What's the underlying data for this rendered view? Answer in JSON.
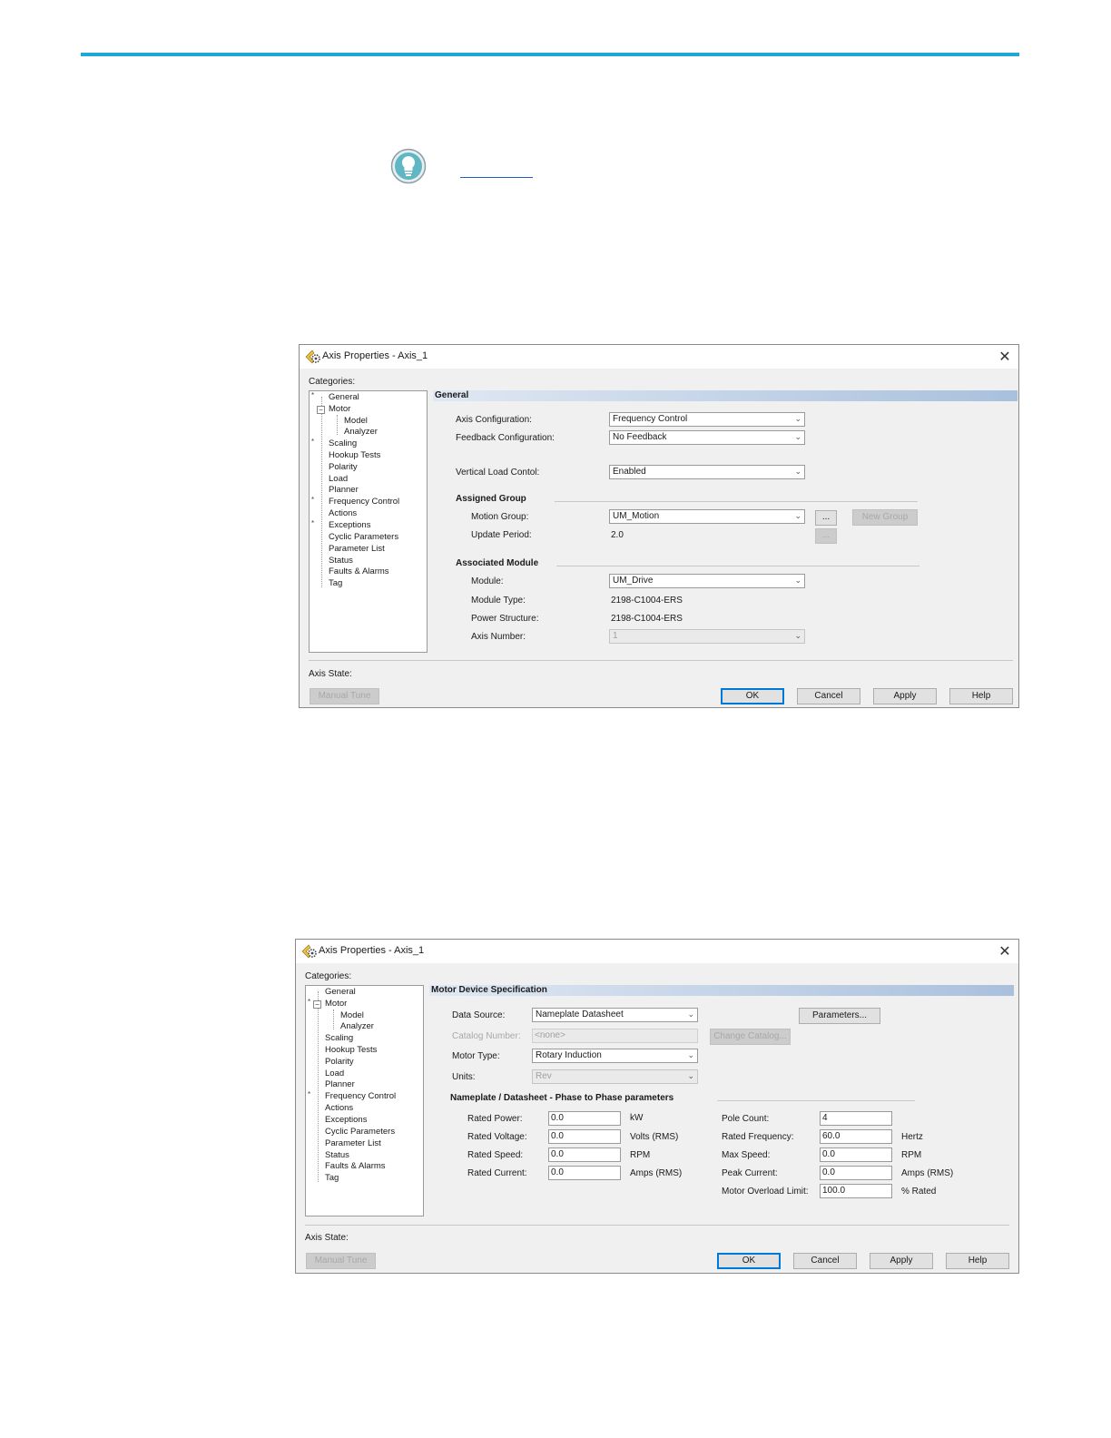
{
  "dialog1": {
    "title": "Axis Properties - Axis_1",
    "categories_label": "Categories:",
    "tree": [
      "General",
      "Motor",
      "Model",
      "Analyzer",
      "Scaling",
      "Hookup Tests",
      "Polarity",
      "Load",
      "Planner",
      "Frequency Control",
      "Actions",
      "Exceptions",
      "Cyclic Parameters",
      "Parameter List",
      "Status",
      "Faults & Alarms",
      "Tag"
    ],
    "section_title": "General",
    "axis_configuration": {
      "label": "Axis Configuration:",
      "value": "Frequency Control"
    },
    "feedback_configuration": {
      "label": "Feedback Configuration:",
      "value": "No Feedback"
    },
    "vertical_load_control": {
      "label": "Vertical Load Contol:",
      "value": "Enabled"
    },
    "assigned_group": {
      "title": "Assigned Group",
      "motion_group_label": "Motion Group:",
      "motion_group_value": "UM_Motion",
      "browse_label": "...",
      "new_group_label": "New Group",
      "update_period_label": "Update Period:",
      "update_period_value": "2.0"
    },
    "associated_module": {
      "title": "Associated Module",
      "module_label": "Module:",
      "module_value": "UM_Drive",
      "module_type_label": "Module Type:",
      "module_type_value": "2198-C1004-ERS",
      "power_structure_label": "Power Structure:",
      "power_structure_value": "2198-C1004-ERS",
      "axis_number_label": "Axis Number:",
      "axis_number_value": "1"
    },
    "axis_state_label": "Axis State:",
    "buttons": {
      "manual_tune": "Manual Tune",
      "ok": "OK",
      "cancel": "Cancel",
      "apply": "Apply",
      "help": "Help"
    }
  },
  "dialog2": {
    "title": "Axis Properties - Axis_1",
    "categories_label": "Categories:",
    "tree": [
      "General",
      "Motor",
      "Model",
      "Analyzer",
      "Scaling",
      "Hookup Tests",
      "Polarity",
      "Load",
      "Planner",
      "Frequency Control",
      "Actions",
      "Exceptions",
      "Cyclic Parameters",
      "Parameter List",
      "Status",
      "Faults & Alarms",
      "Tag"
    ],
    "section_title": "Motor Device Specification",
    "data_source": {
      "label": "Data Source:",
      "value": "Nameplate Datasheet"
    },
    "parameters_button": "Parameters...",
    "catalog_number": {
      "label": "Catalog Number:",
      "value": "<none>"
    },
    "change_catalog_button": "Change Catalog...",
    "motor_type": {
      "label": "Motor Type:",
      "value": "Rotary Induction"
    },
    "units": {
      "label": "Units:",
      "value": "Rev"
    },
    "nameplate_title": "Nameplate / Datasheet - Phase to Phase parameters",
    "left_params": [
      {
        "label": "Rated Power:",
        "value": "0.0",
        "unit": "kW"
      },
      {
        "label": "Rated Voltage:",
        "value": "0.0",
        "unit": "Volts (RMS)"
      },
      {
        "label": "Rated Speed:",
        "value": "0.0",
        "unit": "RPM"
      },
      {
        "label": "Rated Current:",
        "value": "0.0",
        "unit": "Amps (RMS)"
      }
    ],
    "right_params": [
      {
        "label": "Pole Count:",
        "value": "4",
        "unit": ""
      },
      {
        "label": "Rated Frequency:",
        "value": "60.0",
        "unit": "Hertz"
      },
      {
        "label": "Max Speed:",
        "value": "0.0",
        "unit": "RPM"
      },
      {
        "label": "Peak Current:",
        "value": "0.0",
        "unit": "Amps (RMS)"
      },
      {
        "label": "Motor Overload Limit:",
        "value": "100.0",
        "unit": "% Rated"
      }
    ],
    "axis_state_label": "Axis State:",
    "buttons": {
      "manual_tune": "Manual Tune",
      "ok": "OK",
      "cancel": "Cancel",
      "apply": "Apply",
      "help": "Help"
    }
  }
}
